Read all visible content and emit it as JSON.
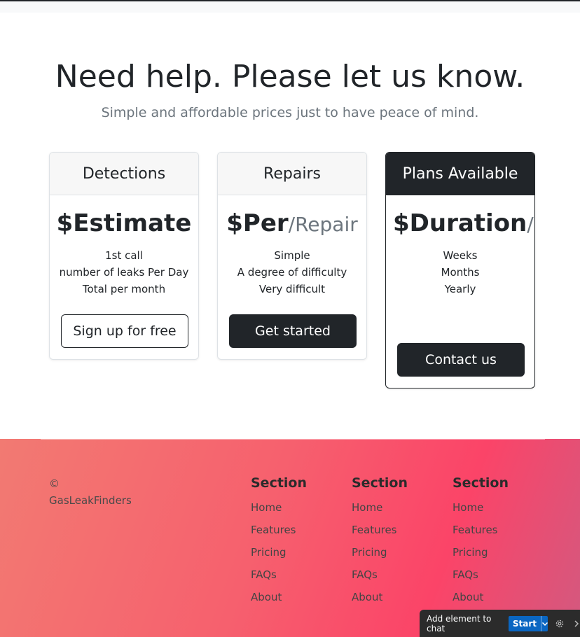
{
  "hero": {
    "title": "Need help. Please let us know.",
    "subtitle": "Simple and affordable prices just to have peace of mind."
  },
  "cards": [
    {
      "header": "Detections",
      "price": "$Estimate",
      "unit": "",
      "features": [
        "1st call",
        "number of leaks Per Day",
        "Total per month"
      ],
      "button": "Sign up for free"
    },
    {
      "header": "Repairs",
      "price": "$Per",
      "unit": "/Repair",
      "features": [
        "Simple",
        "A degree of difficulty",
        "Very difficult"
      ],
      "button": "Get started"
    },
    {
      "header": "Plans Available",
      "price": "$Duration",
      "unit": "/mo",
      "features": [
        "Weeks",
        "Months",
        "Yearly"
      ],
      "button": "Contact us"
    }
  ],
  "footer": {
    "copyright": "© GasLeakFinders",
    "sections": [
      {
        "title": "Section",
        "links": [
          "Home",
          "Features",
          "Pricing",
          "FAQs",
          "About"
        ]
      },
      {
        "title": "Section",
        "links": [
          "Home",
          "Features",
          "Pricing",
          "FAQs",
          "About"
        ]
      },
      {
        "title": "Section",
        "links": [
          "Home",
          "Features",
          "Pricing",
          "FAQs",
          "About"
        ]
      }
    ]
  },
  "chat_toolbar": {
    "label": "Add element to chat",
    "start_label": "Start"
  },
  "colors": {
    "dark": "#212529",
    "muted": "#6c757d",
    "footer_gradient": [
      "#f27a72",
      "#fb4468",
      "#d3597f"
    ],
    "start_button": "#0a66c2"
  },
  "icons": [
    "chevron-down-icon",
    "gear-icon",
    "chevron-right-icon"
  ]
}
